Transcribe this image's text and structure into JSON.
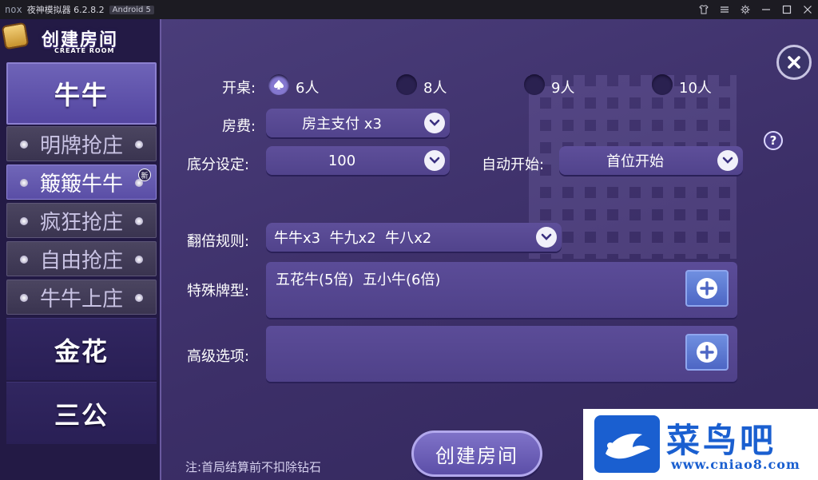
{
  "titlebar": {
    "brand": "nox",
    "title": "夜神模拟器 6.2.8.2",
    "android_badge": "Android 5",
    "controls": [
      "shirt-icon",
      "menu-icon",
      "gear-icon",
      "minimize-icon",
      "maximize-icon",
      "close-icon"
    ]
  },
  "logo": {
    "title": "创建房间",
    "subtitle": "CREATE ROOM"
  },
  "sidebar": {
    "main_category": "牛牛",
    "sub_items": [
      {
        "label": "明牌抢庄",
        "active": false
      },
      {
        "label": "簸簸牛牛",
        "active": true,
        "badge": "新"
      },
      {
        "label": "疯狂抢庄",
        "active": false
      },
      {
        "label": "自由抢庄",
        "active": false
      },
      {
        "label": "牛牛上庄",
        "active": false
      }
    ],
    "other_categories": [
      "金花",
      "三公"
    ]
  },
  "form": {
    "table_label": "开桌:",
    "player_options": [
      {
        "label": "6人",
        "selected": true
      },
      {
        "label": "8人",
        "selected": false
      },
      {
        "label": "9人",
        "selected": false
      },
      {
        "label": "10人",
        "selected": false
      }
    ],
    "fee_label": "房费:",
    "fee_value": "房主支付 x3",
    "base_score_label": "底分设定:",
    "base_score_value": "100",
    "auto_start_label": "自动开始:",
    "auto_start_value": "首位开始",
    "multiplier_label": "翻倍规则:",
    "multiplier_value": "牛牛x3  牛九x2  牛八x2",
    "special_label": "特殊牌型:",
    "special_value": "五花牛(5倍)  五小牛(6倍)",
    "advanced_label": "高级选项:",
    "advanced_value": "",
    "help": "?"
  },
  "create_button": "创建房间",
  "note": "注:首局结算前不扣除钻石",
  "watermark": {
    "text": "菜鸟吧",
    "url": "www.cniao8.com"
  },
  "colors": {
    "accent": "#8578d0",
    "panel": "#3c2f68",
    "sidebar": "#231a45",
    "watermark": "#1a5fd0"
  }
}
